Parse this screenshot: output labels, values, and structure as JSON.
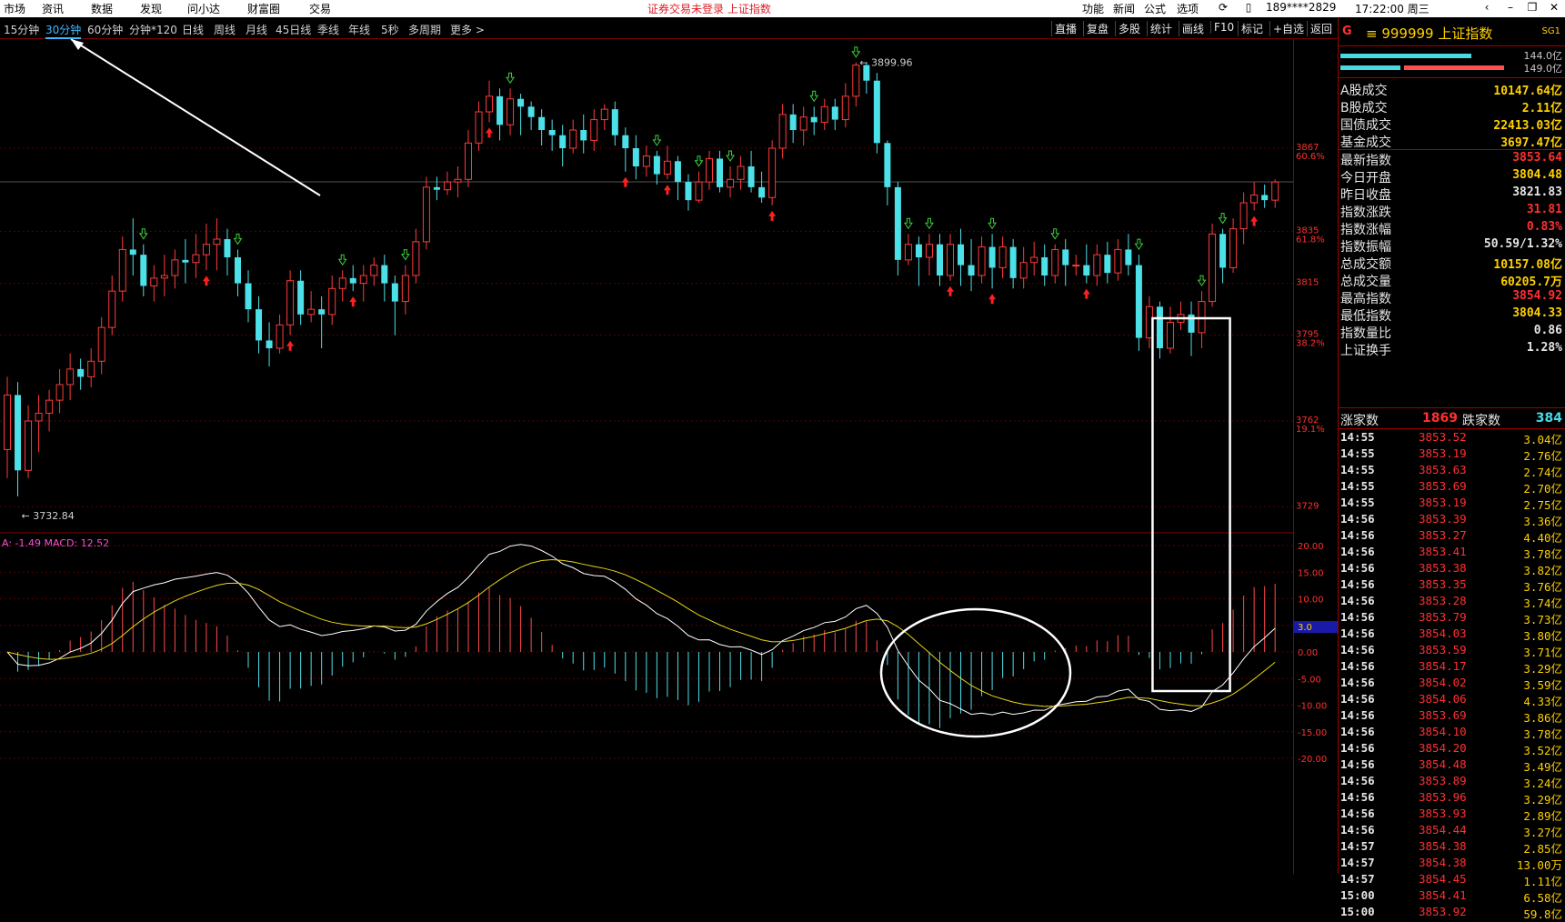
{
  "menubar": {
    "items": [
      "市场",
      "资讯",
      "数据",
      "发现",
      "问小达",
      "财富圈",
      "交易"
    ],
    "notice": "证券交易未登录   上证指数",
    "right_items": [
      "功能",
      "新闻",
      "公式",
      "选项"
    ],
    "user": "189****2829",
    "clock": "17:22:00 周三"
  },
  "toolbar": {
    "periods": [
      "15分钟",
      "30分钟",
      "60分钟",
      "分钟*120",
      "日线",
      "周线",
      "月线",
      "45日线",
      "季线",
      "年线",
      "5秒",
      "多周期",
      "更多 >"
    ],
    "active_period": "30分钟",
    "tools": [
      "直播",
      "复盘",
      "多股",
      "统计",
      "画线",
      "F10",
      "标记",
      "+自选",
      "返回"
    ]
  },
  "chart": {
    "price_min": 3720,
    "price_max": 3902,
    "high_label": "3899.96",
    "low_label": "3732.84",
    "price_axis": [
      {
        "v": 3867,
        "txt": "3867",
        "pct": "60.6%"
      },
      {
        "v": 3835,
        "txt": "3835",
        "pct": "61.8%"
      },
      {
        "v": 3815,
        "txt": "3815",
        "pct": ""
      },
      {
        "v": 3795,
        "txt": "3795",
        "pct": "38.2%"
      },
      {
        "v": 3762,
        "txt": "3762",
        "pct": "19.1%"
      },
      {
        "v": 3729,
        "txt": "3729",
        "pct": ""
      }
    ],
    "macd_label": "A: -1.49  MACD: 12.52",
    "macd_axis": [
      "20.00",
      "15.00",
      "10.00",
      "5.00",
      "0.00",
      "-5.00",
      "-10.00",
      "-15.00",
      "-20.00"
    ],
    "macd_badge": "3.0",
    "candles": [
      [
        3751,
        3772,
        3740,
        3779
      ],
      [
        3772,
        3743,
        3733,
        3777
      ],
      [
        3743,
        3762,
        3740,
        3768
      ],
      [
        3762,
        3765,
        3750,
        3772
      ],
      [
        3765,
        3770,
        3758,
        3774
      ],
      [
        3770,
        3776,
        3765,
        3782
      ],
      [
        3776,
        3782,
        3770,
        3788
      ],
      [
        3782,
        3779,
        3774,
        3786
      ],
      [
        3779,
        3785,
        3775,
        3790
      ],
      [
        3785,
        3798,
        3780,
        3802
      ],
      [
        3798,
        3812,
        3795,
        3818
      ],
      [
        3812,
        3828,
        3808,
        3833
      ],
      [
        3828,
        3826,
        3818,
        3840
      ],
      [
        3826,
        3814,
        3810,
        3830
      ],
      [
        3814,
        3817,
        3808,
        3822
      ],
      [
        3817,
        3818,
        3810,
        3826
      ],
      [
        3818,
        3824,
        3813,
        3828
      ],
      [
        3824,
        3823,
        3815,
        3832
      ],
      [
        3823,
        3826,
        3817,
        3834
      ],
      [
        3826,
        3830,
        3820,
        3838
      ],
      [
        3830,
        3832,
        3820,
        3840
      ],
      [
        3832,
        3825,
        3818,
        3836
      ],
      [
        3825,
        3815,
        3810,
        3828
      ],
      [
        3815,
        3805,
        3800,
        3820
      ],
      [
        3805,
        3793,
        3788,
        3810
      ],
      [
        3793,
        3790,
        3783,
        3800
      ],
      [
        3790,
        3799,
        3788,
        3803
      ],
      [
        3799,
        3816,
        3795,
        3820
      ],
      [
        3816,
        3803,
        3799,
        3820
      ],
      [
        3803,
        3805,
        3800,
        3812
      ],
      [
        3805,
        3803,
        3790,
        3810
      ],
      [
        3803,
        3813,
        3799,
        3818
      ],
      [
        3813,
        3817,
        3808,
        3820
      ],
      [
        3817,
        3815,
        3812,
        3822
      ],
      [
        3815,
        3818,
        3808,
        3822
      ],
      [
        3818,
        3822,
        3814,
        3825
      ],
      [
        3822,
        3815,
        3808,
        3826
      ],
      [
        3815,
        3808,
        3795,
        3818
      ],
      [
        3808,
        3818,
        3803,
        3822
      ],
      [
        3818,
        3831,
        3815,
        3836
      ],
      [
        3831,
        3852,
        3828,
        3856
      ],
      [
        3852,
        3851,
        3847,
        3856
      ],
      [
        3851,
        3854,
        3849,
        3858
      ],
      [
        3854,
        3855,
        3848,
        3860
      ],
      [
        3855,
        3869,
        3852,
        3874
      ],
      [
        3869,
        3881,
        3866,
        3885
      ],
      [
        3881,
        3887,
        3877,
        3893
      ],
      [
        3887,
        3876,
        3870,
        3890
      ],
      [
        3876,
        3886,
        3872,
        3890
      ],
      [
        3886,
        3883,
        3872,
        3888
      ],
      [
        3883,
        3879,
        3874,
        3885
      ],
      [
        3879,
        3874,
        3868,
        3882
      ],
      [
        3874,
        3872,
        3866,
        3878
      ],
      [
        3872,
        3867,
        3860,
        3876
      ],
      [
        3867,
        3874,
        3865,
        3878
      ],
      [
        3874,
        3870,
        3865,
        3880
      ],
      [
        3870,
        3878,
        3866,
        3882
      ],
      [
        3878,
        3882,
        3874,
        3884
      ],
      [
        3882,
        3872,
        3868,
        3885
      ],
      [
        3872,
        3867,
        3858,
        3875
      ],
      [
        3867,
        3860,
        3855,
        3872
      ],
      [
        3860,
        3864,
        3856,
        3868
      ],
      [
        3864,
        3857,
        3853,
        3866
      ],
      [
        3857,
        3862,
        3855,
        3868
      ],
      [
        3862,
        3854,
        3847,
        3864
      ],
      [
        3854,
        3847,
        3843,
        3857
      ],
      [
        3847,
        3854,
        3846,
        3858
      ],
      [
        3854,
        3863,
        3851,
        3866
      ],
      [
        3863,
        3852,
        3850,
        3866
      ],
      [
        3852,
        3855,
        3848,
        3860
      ],
      [
        3855,
        3860,
        3851,
        3864
      ],
      [
        3860,
        3852,
        3850,
        3866
      ],
      [
        3852,
        3848,
        3846,
        3858
      ],
      [
        3848,
        3867,
        3845,
        3870
      ],
      [
        3867,
        3880,
        3863,
        3884
      ],
      [
        3880,
        3874,
        3869,
        3884
      ],
      [
        3874,
        3879,
        3868,
        3883
      ],
      [
        3879,
        3877,
        3872,
        3883
      ],
      [
        3877,
        3883,
        3874,
        3886
      ],
      [
        3883,
        3878,
        3874,
        3886
      ],
      [
        3878,
        3887,
        3875,
        3892
      ],
      [
        3887,
        3899,
        3883,
        3900
      ],
      [
        3899,
        3893,
        3888,
        3900
      ],
      [
        3893,
        3869,
        3865,
        3896
      ],
      [
        3869,
        3852,
        3845,
        3870
      ],
      [
        3852,
        3824,
        3818,
        3854
      ],
      [
        3824,
        3830,
        3822,
        3834
      ],
      [
        3830,
        3825,
        3814,
        3833
      ],
      [
        3825,
        3830,
        3818,
        3834
      ],
      [
        3830,
        3818,
        3814,
        3834
      ],
      [
        3818,
        3830,
        3816,
        3834
      ],
      [
        3830,
        3822,
        3814,
        3836
      ],
      [
        3822,
        3818,
        3812,
        3832
      ],
      [
        3818,
        3829,
        3815,
        3833
      ],
      [
        3829,
        3821,
        3813,
        3834
      ],
      [
        3821,
        3829,
        3817,
        3833
      ],
      [
        3829,
        3817,
        3813,
        3832
      ],
      [
        3817,
        3823,
        3813,
        3829
      ],
      [
        3823,
        3825,
        3818,
        3831
      ],
      [
        3825,
        3818,
        3814,
        3830
      ],
      [
        3818,
        3828,
        3815,
        3830
      ],
      [
        3828,
        3822,
        3814,
        3832
      ],
      [
        3822,
        3822,
        3818,
        3826
      ],
      [
        3822,
        3818,
        3815,
        3830
      ],
      [
        3818,
        3826,
        3814,
        3830
      ],
      [
        3826,
        3819,
        3815,
        3831
      ],
      [
        3819,
        3828,
        3816,
        3832
      ],
      [
        3828,
        3822,
        3818,
        3834
      ],
      [
        3822,
        3794,
        3789,
        3826
      ],
      [
        3794,
        3806,
        3790,
        3810
      ],
      [
        3806,
        3790,
        3786,
        3808
      ],
      [
        3790,
        3800,
        3788,
        3806
      ],
      [
        3800,
        3803,
        3797,
        3808
      ],
      [
        3803,
        3796,
        3787,
        3808
      ],
      [
        3796,
        3808,
        3790,
        3812
      ],
      [
        3808,
        3834,
        3806,
        3838
      ],
      [
        3834,
        3821,
        3815,
        3836
      ],
      [
        3821,
        3836,
        3819,
        3840
      ],
      [
        3836,
        3846,
        3830,
        3850
      ],
      [
        3846,
        3849,
        3843,
        3854
      ],
      [
        3849,
        3847,
        3844,
        3853
      ],
      [
        3847,
        3854,
        3844,
        3855
      ]
    ],
    "up_arrows": [
      19,
      27,
      33,
      46,
      59,
      63,
      73,
      90,
      94,
      103,
      119,
      128
    ],
    "down_arrows": [
      13,
      22,
      32,
      38,
      48,
      62,
      66,
      69,
      77,
      81,
      86,
      88,
      94,
      100,
      108,
      114,
      116
    ]
  },
  "sidebar": {
    "flag": "G",
    "code": "≡ 999999 上证指数",
    "tag": "SG1",
    "bar_values": [
      "144.0亿",
      "149.0亿"
    ],
    "rows": [
      {
        "label": "A股成交",
        "value": "10147.64亿",
        "color": "#ffd100"
      },
      {
        "label": "B股成交",
        "value": "2.11亿",
        "color": "#ffd100"
      },
      {
        "label": "国债成交",
        "value": "22413.03亿",
        "color": "#ffd100"
      },
      {
        "label": "基金成交",
        "value": "3697.47亿",
        "color": "#ffd100"
      },
      {
        "label": "最新指数",
        "value": "3853.64",
        "color": "#ff3030",
        "sep": true
      },
      {
        "label": "今日开盘",
        "value": "3804.48",
        "color": "#ffd100"
      },
      {
        "label": "昨日收盘",
        "value": "3821.83",
        "color": "#e6e6e6"
      },
      {
        "label": "指数涨跌",
        "value": "31.81",
        "color": "#ff3030"
      },
      {
        "label": "指数涨幅",
        "value": "0.83%",
        "color": "#ff3030"
      },
      {
        "label": "指数振幅",
        "value": "50.59/1.32%",
        "color": "#e6e6e6"
      },
      {
        "label": "总成交额",
        "value": "10157.08亿",
        "color": "#ffd100"
      },
      {
        "label": "总成交量",
        "value": "60205.7万",
        "color": "#ffd100"
      },
      {
        "label": "最高指数",
        "value": "3854.92",
        "color": "#ff3030"
      },
      {
        "label": "最低指数",
        "value": "3804.33",
        "color": "#ffd100"
      },
      {
        "label": "指数量比",
        "value": "0.86",
        "color": "#e6e6e6"
      },
      {
        "label": "上证换手",
        "value": "1.28%",
        "color": "#e6e6e6"
      }
    ],
    "up_label": "涨家数",
    "up_count": "1869",
    "down_label": "跌家数",
    "down_count": "384",
    "ticks": [
      {
        "t": "14:55",
        "p": "3853.52",
        "v": "3.04亿"
      },
      {
        "t": "14:55",
        "p": "3853.19",
        "v": "2.76亿"
      },
      {
        "t": "14:55",
        "p": "3853.63",
        "v": "2.74亿"
      },
      {
        "t": "14:55",
        "p": "3853.69",
        "v": "2.70亿"
      },
      {
        "t": "14:55",
        "p": "3853.19",
        "v": "2.75亿"
      },
      {
        "t": "14:56",
        "p": "3853.39",
        "v": "3.36亿"
      },
      {
        "t": "14:56",
        "p": "3853.27",
        "v": "4.40亿"
      },
      {
        "t": "14:56",
        "p": "3853.41",
        "v": "3.78亿"
      },
      {
        "t": "14:56",
        "p": "3853.38",
        "v": "3.82亿"
      },
      {
        "t": "14:56",
        "p": "3853.35",
        "v": "3.76亿"
      },
      {
        "t": "14:56",
        "p": "3853.28",
        "v": "3.74亿"
      },
      {
        "t": "14:56",
        "p": "3853.79",
        "v": "3.73亿"
      },
      {
        "t": "14:56",
        "p": "3854.03",
        "v": "3.80亿"
      },
      {
        "t": "14:56",
        "p": "3853.59",
        "v": "3.71亿"
      },
      {
        "t": "14:56",
        "p": "3854.17",
        "v": "3.29亿"
      },
      {
        "t": "14:56",
        "p": "3854.02",
        "v": "3.59亿"
      },
      {
        "t": "14:56",
        "p": "3854.06",
        "v": "4.33亿"
      },
      {
        "t": "14:56",
        "p": "3853.69",
        "v": "3.86亿"
      },
      {
        "t": "14:56",
        "p": "3854.10",
        "v": "3.78亿"
      },
      {
        "t": "14:56",
        "p": "3854.20",
        "v": "3.52亿"
      },
      {
        "t": "14:56",
        "p": "3854.48",
        "v": "3.49亿"
      },
      {
        "t": "14:56",
        "p": "3853.89",
        "v": "3.24亿"
      },
      {
        "t": "14:56",
        "p": "3853.96",
        "v": "3.29亿"
      },
      {
        "t": "14:56",
        "p": "3853.93",
        "v": "2.89亿"
      },
      {
        "t": "14:56",
        "p": "3854.44",
        "v": "3.27亿"
      },
      {
        "t": "14:57",
        "p": "3854.38",
        "v": "2.85亿"
      },
      {
        "t": "14:57",
        "p": "3854.38",
        "v": "13.00万"
      },
      {
        "t": "14:57",
        "p": "3854.45",
        "v": "1.11亿"
      },
      {
        "t": "15:00",
        "p": "3854.41",
        "v": "6.58亿"
      },
      {
        "t": "15:00",
        "p": "3853.92",
        "v": "59.8亿"
      }
    ]
  }
}
